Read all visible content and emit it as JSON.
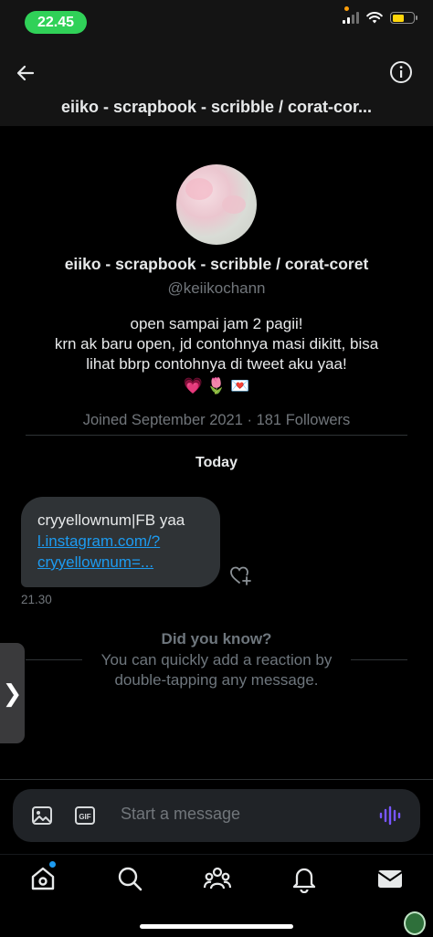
{
  "status_bar": {
    "time": "22.45",
    "battery_level": 0.55
  },
  "header": {
    "title": "eiiko - scrapbook - scribble / corat-cor..."
  },
  "profile": {
    "display_name": "eiiko - scrapbook - scribble / corat-coret",
    "handle": "@keiikochann",
    "bio_lines": [
      "open sampai jam 2 pagii!",
      "krn ak baru open, jd contohnya masi dikitt, bisa",
      "lihat bbrp contohnya di tweet aku yaa!"
    ],
    "bio_emojis": "💗 🌷 💌",
    "joined": "Joined September 2021 · 181 Followers"
  },
  "conversation": {
    "day_label": "Today",
    "message": {
      "text": "cryyellownum|FB yaa",
      "link_line1": "l.instagram.com/?",
      "link_line2": "cryyellownum=...",
      "time": "21.30"
    },
    "tip": {
      "title": "Did you know?",
      "body_line1": "You can quickly add a reaction by",
      "body_line2": "double-tapping any message."
    }
  },
  "side_handle": {
    "glyph": "❯"
  },
  "composer": {
    "placeholder": "Start a message"
  },
  "nav": [
    "home-icon",
    "search-icon",
    "communities-icon",
    "notifications-icon",
    "messages-icon"
  ],
  "colors": {
    "accent": "#1d9bf0",
    "bubble": "#2f3336",
    "background": "#000000",
    "time_pill": "#30d158"
  }
}
